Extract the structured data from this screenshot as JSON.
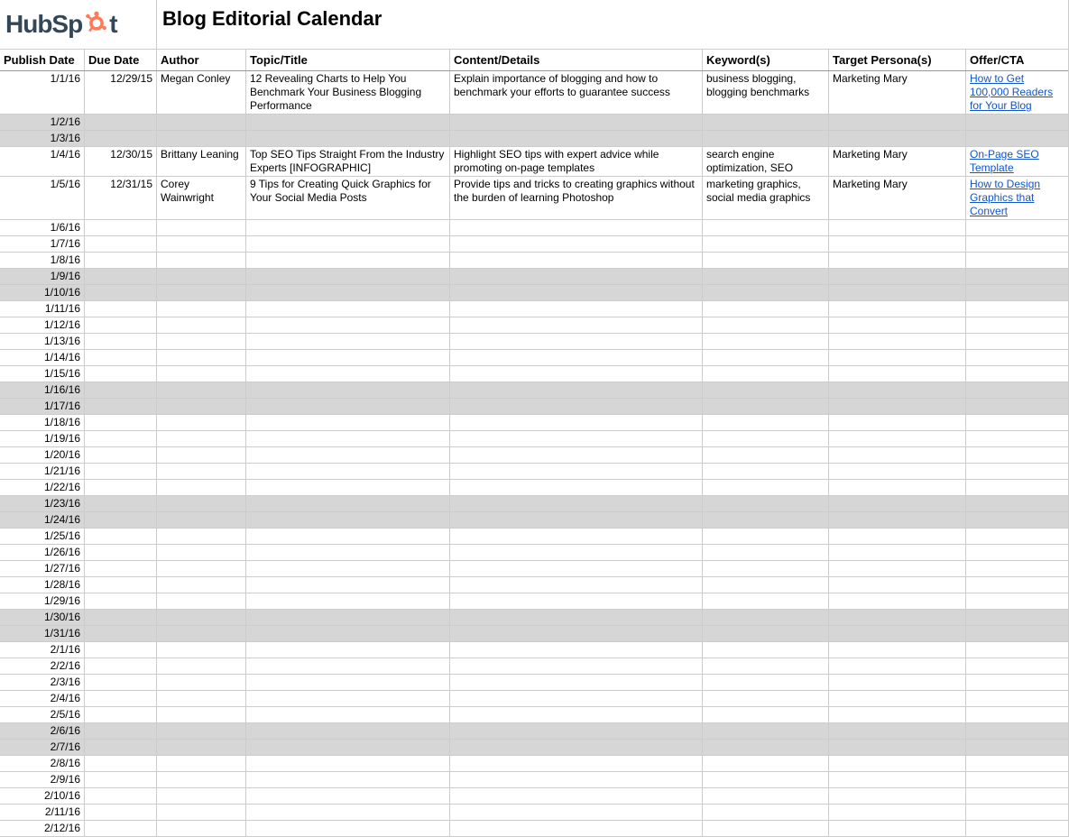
{
  "logo_text_a": "HubSp",
  "logo_text_b": "t",
  "title": "Blog Editorial Calendar",
  "columns": {
    "publish": "Publish Date",
    "due": "Due Date",
    "author": "Author",
    "topic": "Topic/Title",
    "content": "Content/Details",
    "keywords": "Keyword(s)",
    "persona": "Target Persona(s)",
    "offer": "Offer/CTA"
  },
  "rows": [
    {
      "publish": "1/1/16",
      "due": "12/29/15",
      "author": "Megan Conley",
      "topic": "12 Revealing Charts to Help You Benchmark Your Business Blogging Performance",
      "content": "Explain importance of blogging and how to benchmark your efforts to guarantee success",
      "keywords": "business blogging, blogging benchmarks",
      "persona": "Marketing Mary",
      "offer": "How to Get 100,000 Readers for Your Blog",
      "tall": true,
      "link": true,
      "shaded": false
    },
    {
      "publish": "1/2/16",
      "shaded": true
    },
    {
      "publish": "1/3/16",
      "shaded": true
    },
    {
      "publish": "1/4/16",
      "due": "12/30/15",
      "author": "Brittany Leaning",
      "topic": "Top SEO Tips Straight From the Industry Experts [INFOGRAPHIC]",
      "content": "Highlight SEO tips with expert advice while promoting on-page templates",
      "keywords": "search engine optimization, SEO",
      "persona": "Marketing Mary",
      "offer": "On-Page SEO Template",
      "tall": true,
      "link": true
    },
    {
      "publish": "1/5/16",
      "due": "12/31/15",
      "author": "Corey Wainwright",
      "topic": "9 Tips for Creating Quick Graphics for Your Social Media Posts",
      "content": "Provide tips and tricks to creating graphics without the burden of learning Photoshop",
      "keywords": "marketing graphics, social media graphics",
      "persona": "Marketing Mary",
      "offer": "How to Design Graphics that Convert",
      "tall": true,
      "link": true
    },
    {
      "publish": "1/6/16"
    },
    {
      "publish": "1/7/16"
    },
    {
      "publish": "1/8/16"
    },
    {
      "publish": "1/9/16",
      "shaded": true
    },
    {
      "publish": "1/10/16",
      "shaded": true
    },
    {
      "publish": "1/11/16"
    },
    {
      "publish": "1/12/16"
    },
    {
      "publish": "1/13/16"
    },
    {
      "publish": "1/14/16"
    },
    {
      "publish": "1/15/16"
    },
    {
      "publish": "1/16/16",
      "shaded": true
    },
    {
      "publish": "1/17/16",
      "shaded": true
    },
    {
      "publish": "1/18/16"
    },
    {
      "publish": "1/19/16"
    },
    {
      "publish": "1/20/16"
    },
    {
      "publish": "1/21/16"
    },
    {
      "publish": "1/22/16"
    },
    {
      "publish": "1/23/16",
      "shaded": true
    },
    {
      "publish": "1/24/16",
      "shaded": true
    },
    {
      "publish": "1/25/16"
    },
    {
      "publish": "1/26/16"
    },
    {
      "publish": "1/27/16"
    },
    {
      "publish": "1/28/16"
    },
    {
      "publish": "1/29/16"
    },
    {
      "publish": "1/30/16",
      "shaded": true
    },
    {
      "publish": "1/31/16",
      "shaded": true
    },
    {
      "publish": "2/1/16"
    },
    {
      "publish": "2/2/16"
    },
    {
      "publish": "2/3/16"
    },
    {
      "publish": "2/4/16"
    },
    {
      "publish": "2/5/16"
    },
    {
      "publish": "2/6/16",
      "shaded": true
    },
    {
      "publish": "2/7/16",
      "shaded": true
    },
    {
      "publish": "2/8/16"
    },
    {
      "publish": "2/9/16"
    },
    {
      "publish": "2/10/16"
    },
    {
      "publish": "2/11/16"
    },
    {
      "publish": "2/12/16"
    }
  ]
}
